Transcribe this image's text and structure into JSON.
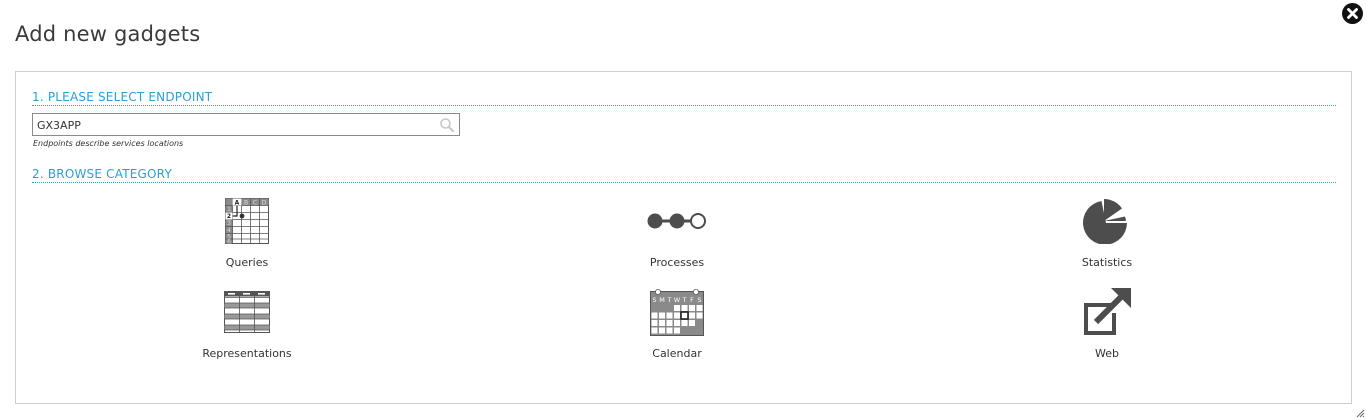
{
  "dialog": {
    "title": "Add new gadgets"
  },
  "endpoint": {
    "heading": "1. PLEASE SELECT ENDPOINT",
    "value": "GX3APP",
    "help": "Endpoints describe services locations"
  },
  "browse": {
    "heading": "2. BROWSE CATEGORY",
    "gadgets": [
      {
        "label": "Queries",
        "icon": "spreadsheet-icon"
      },
      {
        "label": "Processes",
        "icon": "process-flow-icon"
      },
      {
        "label": "Statistics",
        "icon": "pie-chart-icon"
      },
      {
        "label": "Representations",
        "icon": "table-icon"
      },
      {
        "label": "Calendar",
        "icon": "calendar-icon"
      },
      {
        "label": "Web",
        "icon": "external-link-icon"
      }
    ]
  },
  "queries_icon": {
    "columns": [
      "A",
      "B",
      "C",
      "D"
    ],
    "rows": [
      "1",
      "2",
      "3",
      "4",
      "5",
      "6"
    ]
  },
  "calendar_icon": {
    "weekdays": [
      "S",
      "M",
      "T",
      "W",
      "T",
      "F",
      "S"
    ]
  },
  "colors": {
    "accent": "#2b9fd6",
    "icon": "#555555",
    "border": "#cfcfcf"
  }
}
